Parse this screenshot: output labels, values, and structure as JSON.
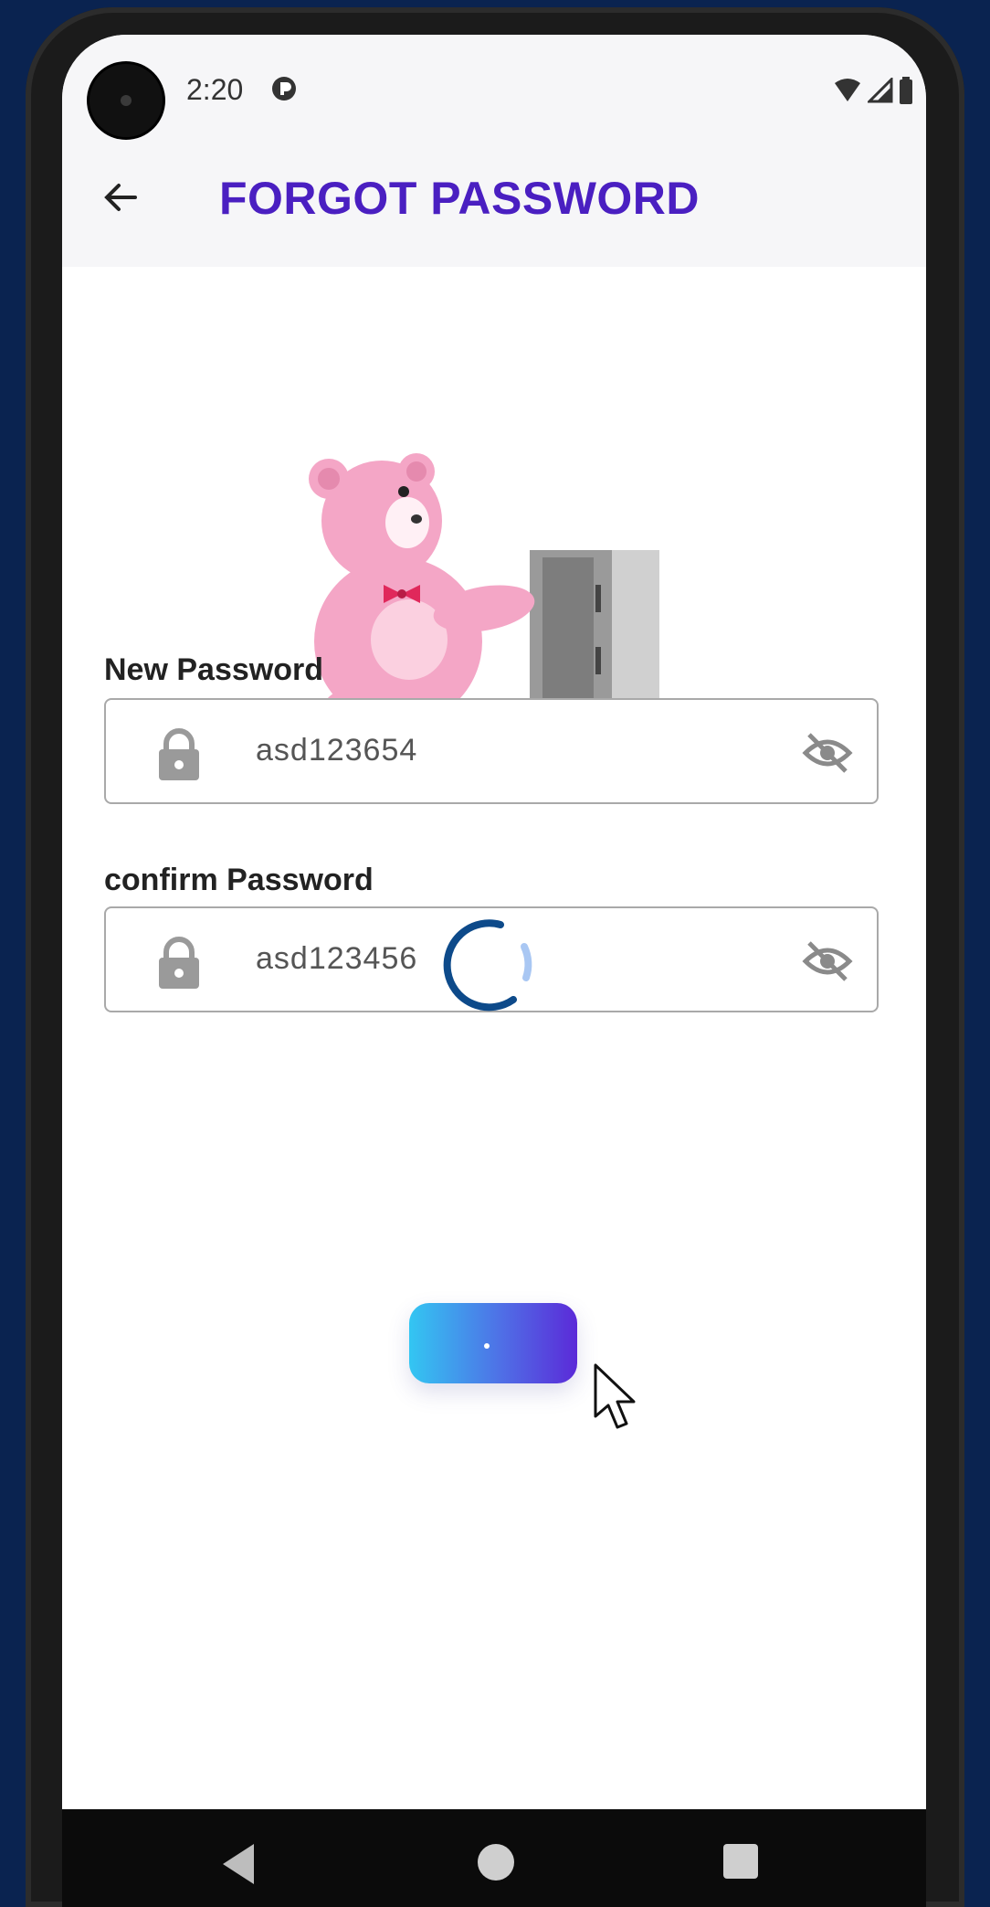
{
  "status_bar": {
    "time": "2:20"
  },
  "app_bar": {
    "title": "FORGOT PASSWORD"
  },
  "form": {
    "new_password": {
      "label": "New Password",
      "value": "asd123654"
    },
    "confirm_password": {
      "label": "confirm Password",
      "value": "asd123456"
    }
  },
  "icons": {
    "back": "arrow-left-icon",
    "lock": "lock-icon",
    "visibility": "eye-off-icon",
    "spinner": "loading-spinner-icon",
    "cursor": "mouse-pointer-icon"
  },
  "colors": {
    "title": "#4a1fc1",
    "button_gradient_start": "#33c6f2",
    "button_gradient_end": "#5b2ad8",
    "background": "#0a2350"
  }
}
